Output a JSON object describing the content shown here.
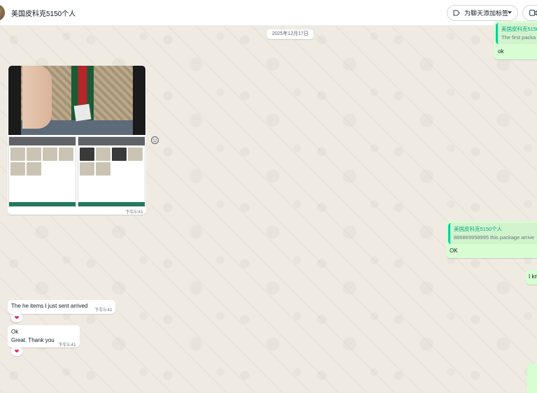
{
  "header": {
    "chat_title": "美国皮科克5150个人",
    "label_button": "为聊天添加标签"
  },
  "date_divider": "2025年12月17日",
  "messages": {
    "top_reply": {
      "quote_author": "美国皮科克5150",
      "quote_text": "The first packa",
      "text": "ok"
    },
    "album": {
      "time": "下午5:41"
    },
    "mid_reply": {
      "quote_author": "美国皮科克5150个人",
      "quote_text": "886869958995 this package arrive",
      "text": "OK"
    },
    "partial_out": {
      "text": "I kn"
    },
    "in_1": {
      "text": "The he items I just sent arrived",
      "time": "下午5:41",
      "reaction": "❤"
    },
    "in_2": {
      "line1": "Ok",
      "line2": "Great. Thank you",
      "time": "下午5:41",
      "reaction": "❤"
    }
  },
  "colors": {
    "outgoing_bubble": "#d9fdd3",
    "incoming_bubble": "#ffffff",
    "quote_accent": "#06cf9c",
    "wallpaper": "#efeae2"
  }
}
